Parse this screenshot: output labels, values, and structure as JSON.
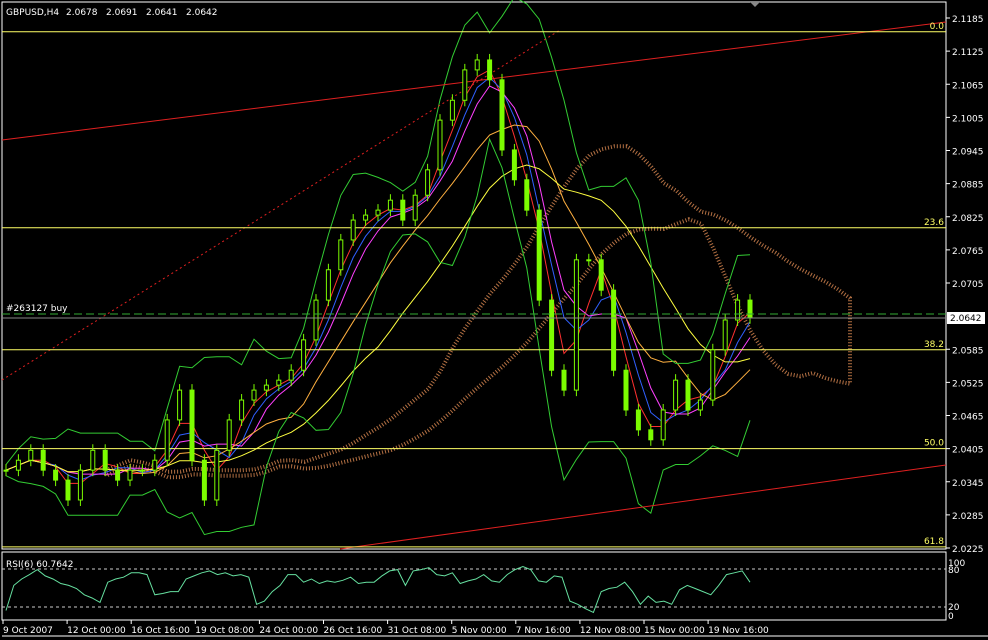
{
  "header": {
    "symbol": "GBPUSD,H4",
    "open": "2.0678",
    "high": "2.0691",
    "low": "2.0641",
    "close": "2.0642"
  },
  "order_label": "#263127 buy",
  "bid_label": "2.0642",
  "rsi_label": "RSI(6) 60.7642",
  "colors": {
    "background": "#000000",
    "candles": "#7CFC00",
    "fibo": "#FFFF66",
    "channel": "#FF2020",
    "cloud": "#FFA060",
    "bollinger": "#33CC33",
    "rsi": "#66E0A0",
    "order_line": "#33AA33"
  },
  "fibo_levels": [
    {
      "label": "0.0",
      "price": 2.116
    },
    {
      "label": "23.6",
      "price": 2.0805
    },
    {
      "label": "38.2",
      "price": 2.0584
    },
    {
      "label": "50.0",
      "price": 2.0405
    },
    {
      "label": "61.8",
      "price": 2.0227
    }
  ],
  "chart_data": [
    {
      "type": "candlestick",
      "title": "GBPUSD,H4",
      "y_ticks": [
        "2.1185",
        "2.1125",
        "2.1065",
        "2.1005",
        "2.0945",
        "2.0885",
        "2.0825",
        "2.0765",
        "2.0705",
        "2.0585",
        "2.0525",
        "2.0465",
        "2.0405",
        "2.0345",
        "2.0285",
        "2.0225"
      ],
      "ylim": [
        2.0225,
        2.1185
      ],
      "x_ticks": [
        "9 Oct 2007",
        "12 Oct 00:00",
        "16 Oct 16:00",
        "19 Oct 08:00",
        "24 Oct 00:00",
        "26 Oct 16:00",
        "31 Oct 08:00",
        "5 Nov 00:00",
        "7 Nov 16:00",
        "12 Nov 08:00",
        "15 Nov 00:00",
        "19 Nov 16:00"
      ],
      "close": [
        2.0366,
        2.0384,
        2.0402,
        2.0366,
        2.0348,
        2.0312,
        2.0366,
        2.0402,
        2.0366,
        2.0348,
        2.0366,
        2.0366,
        2.0384,
        2.0457,
        2.0511,
        2.0384,
        2.0312,
        2.0402,
        2.0457,
        2.0493,
        2.0511,
        2.052,
        2.0529,
        2.0547,
        2.0602,
        2.0674,
        2.0729,
        2.0783,
        2.0819,
        2.0828,
        2.0837,
        2.0855,
        2.0819,
        2.0864,
        2.091,
        2.1,
        2.1036,
        2.1091,
        2.1109,
        2.1073,
        2.0946,
        2.0892,
        2.0837,
        2.0674,
        2.0547,
        2.0511,
        2.0747,
        2.0747,
        2.0692,
        2.0547,
        2.0475,
        2.0439,
        2.0421,
        2.0475,
        2.0529,
        2.0475,
        2.0493,
        2.0584,
        2.0638,
        2.0674,
        2.0642
      ],
      "last_price": 2.0642
    },
    {
      "type": "line",
      "title": "RSI(6) 60.7642",
      "y_ticks": [
        "100",
        "80",
        "20",
        "0"
      ],
      "ylim": [
        0,
        100
      ],
      "values": [
        15,
        55,
        65,
        72,
        80,
        70,
        65,
        58,
        55,
        50,
        40,
        35,
        28,
        60,
        65,
        68,
        75,
        75,
        72,
        40,
        42,
        45,
        45,
        65,
        70,
        75,
        78,
        72,
        75,
        70,
        72,
        68,
        25,
        30,
        45,
        55,
        72,
        72,
        60,
        65,
        58,
        62,
        60,
        63,
        68,
        58,
        60,
        60,
        70,
        78,
        80,
        55,
        78,
        80,
        83,
        72,
        70,
        75,
        58,
        62,
        65,
        72,
        62,
        60,
        72,
        80,
        85,
        80,
        62,
        60,
        70,
        68,
        30,
        25,
        18,
        12,
        45,
        50,
        52,
        60,
        45,
        25,
        38,
        28,
        30,
        25,
        48,
        55,
        50,
        45,
        40,
        55,
        72,
        75,
        78,
        60
      ]
    }
  ]
}
